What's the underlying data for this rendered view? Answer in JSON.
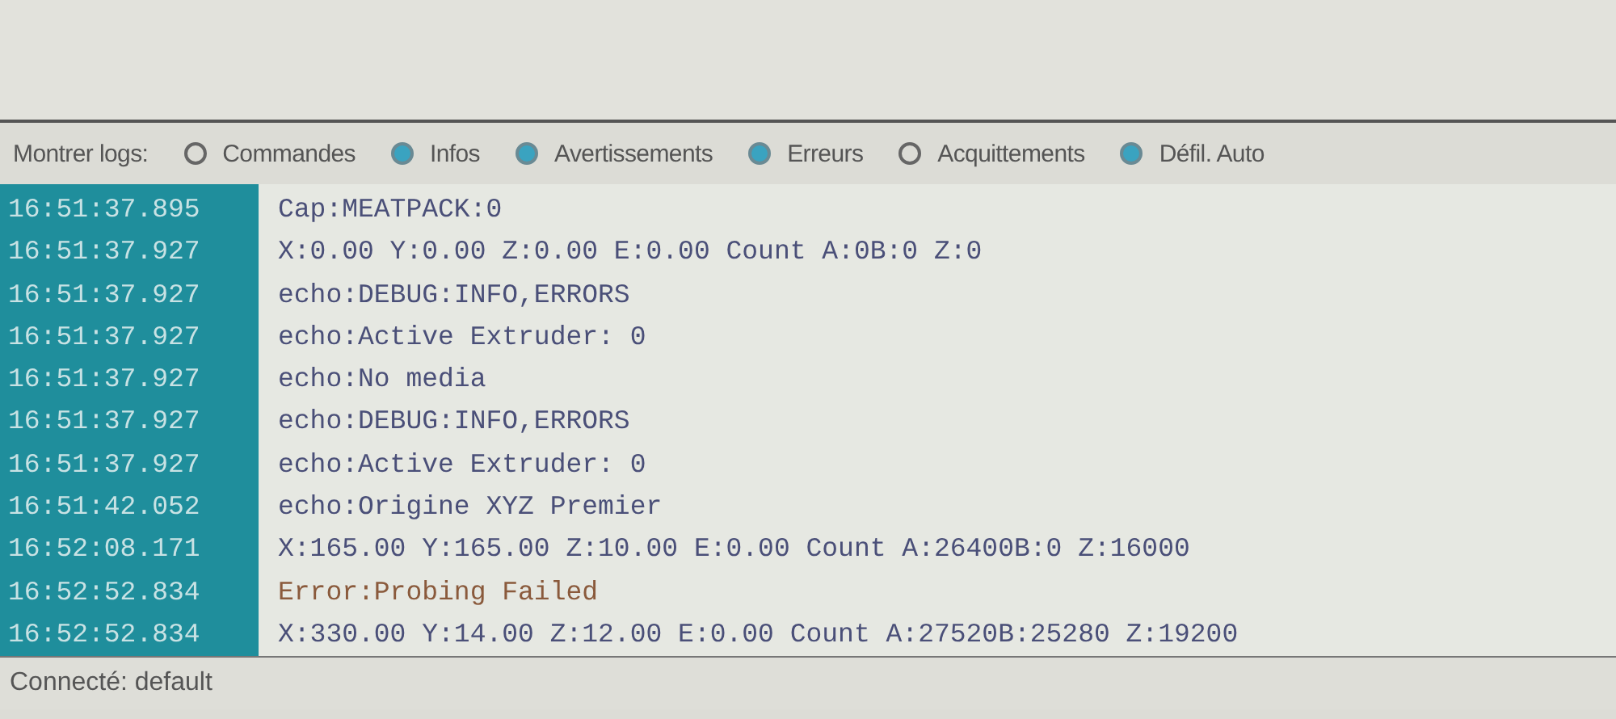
{
  "filter_bar": {
    "label": "Montrer logs:",
    "options": [
      {
        "label": "Commandes",
        "selected": false
      },
      {
        "label": "Infos",
        "selected": true
      },
      {
        "label": "Avertissements",
        "selected": true
      },
      {
        "label": "Erreurs",
        "selected": true
      },
      {
        "label": "Acquittements",
        "selected": false
      },
      {
        "label": "Défil. Auto",
        "selected": true
      }
    ]
  },
  "log": [
    {
      "time": "16:51:37.895",
      "message": "Cap:MEATPACK:0",
      "kind": "info"
    },
    {
      "time": "16:51:37.927",
      "message": "X:0.00 Y:0.00 Z:0.00 E:0.00 Count A:0B:0 Z:0",
      "kind": "info"
    },
    {
      "time": "16:51:37.927",
      "message": "echo:DEBUG:INFO,ERRORS",
      "kind": "info"
    },
    {
      "time": "16:51:37.927",
      "message": "echo:Active Extruder: 0",
      "kind": "info"
    },
    {
      "time": "16:51:37.927",
      "message": "echo:No media",
      "kind": "info"
    },
    {
      "time": "16:51:37.927",
      "message": "echo:DEBUG:INFO,ERRORS",
      "kind": "info"
    },
    {
      "time": "16:51:37.927",
      "message": "echo:Active Extruder: 0",
      "kind": "info"
    },
    {
      "time": "16:51:42.052",
      "message": "echo:Origine XYZ Premier",
      "kind": "info"
    },
    {
      "time": "16:52:08.171",
      "message": "X:165.00 Y:165.00 Z:10.00 E:0.00 Count A:26400B:0 Z:16000",
      "kind": "info"
    },
    {
      "time": "16:52:52.834",
      "message": "Error:Probing Failed",
      "kind": "error"
    },
    {
      "time": "16:52:52.834",
      "message": "X:330.00 Y:14.00 Z:12.00 E:0.00 Count A:27520B:25280 Z:19200",
      "kind": "info"
    }
  ],
  "status_bar": {
    "text": "Connecté: default"
  }
}
